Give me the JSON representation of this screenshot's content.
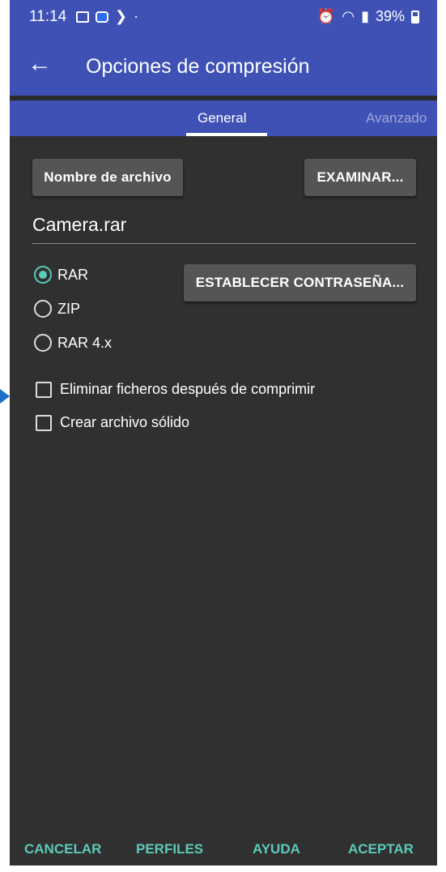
{
  "status_bar": {
    "time": "11:14",
    "dot": "·",
    "battery": "39%",
    "icons": [
      "gallery-icon",
      "camera-app-icon",
      "chat-icon",
      "alarm-icon",
      "wifi-icon",
      "signal-icon",
      "battery-icon"
    ]
  },
  "app_bar": {
    "back_icon": "←",
    "title": "Opciones de compresión"
  },
  "tabs": [
    {
      "label": "General",
      "active": true
    },
    {
      "label": "Avanzado",
      "active": false
    }
  ],
  "general": {
    "filename_button": "Nombre de archivo",
    "browse_button": "EXAMINAR...",
    "filename_value": "Camera.rar",
    "formats": [
      {
        "label": "RAR",
        "selected": true
      },
      {
        "label": "ZIP",
        "selected": false
      },
      {
        "label": "RAR 4.x",
        "selected": false
      }
    ],
    "password_button": "ESTABLECER CONTRASEÑA...",
    "options": [
      {
        "label": "Eliminar ficheros después de comprimir",
        "checked": false
      },
      {
        "label": "Crear archivo sólido",
        "checked": false
      }
    ]
  },
  "footer": {
    "cancel": "CANCELAR",
    "profiles": "PERFILES",
    "help": "AYUDA",
    "accept": "ACEPTAR"
  },
  "colors": {
    "primary": "#3f51b5",
    "background": "#303030",
    "accent": "#5ccab9",
    "button": "#555555"
  }
}
